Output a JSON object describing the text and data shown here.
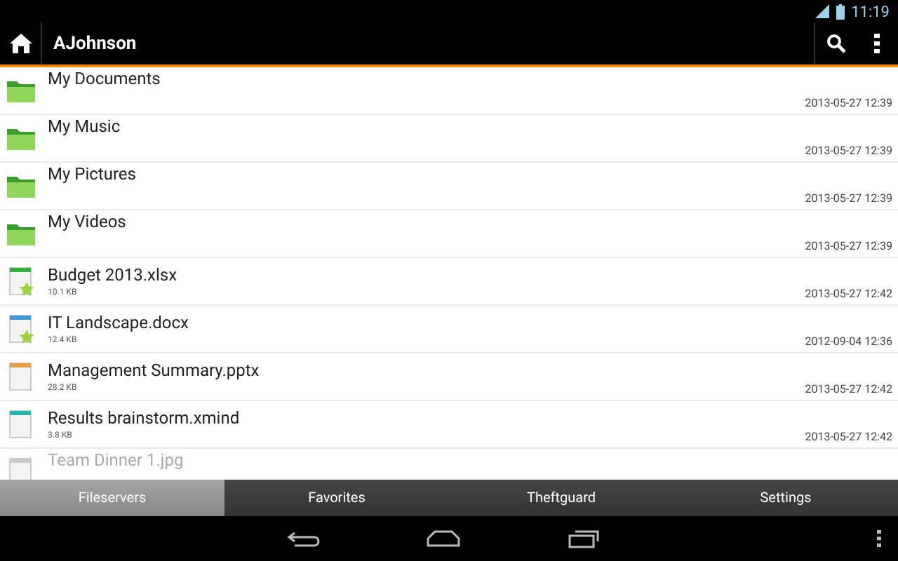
{
  "status_bar": {
    "time": "11:19"
  },
  "action_bar": {
    "title": "AJohnson"
  },
  "files": [
    {
      "kind": "folder",
      "name": "My Documents",
      "date": "2013-05-27 12:39"
    },
    {
      "kind": "folder",
      "name": "My Music",
      "date": "2013-05-27 12:39"
    },
    {
      "kind": "folder",
      "name": "My Pictures",
      "date": "2013-05-27 12:39"
    },
    {
      "kind": "folder",
      "name": "My Videos",
      "date": "2013-05-27 12:39"
    },
    {
      "kind": "file",
      "name": "Budget 2013.xlsx",
      "size": "10.1 KB",
      "date": "2013-05-27 12:42",
      "color": "#2fae3a",
      "favorite": true
    },
    {
      "kind": "file",
      "name": "IT Landscape.docx",
      "size": "12.4 KB",
      "date": "2012-09-04 12:36",
      "color": "#3a9ad9",
      "favorite": true
    },
    {
      "kind": "file",
      "name": "Management Summary.pptx",
      "size": "28.2 KB",
      "date": "2013-05-27 12:42",
      "color": "#e89a3c",
      "favorite": false
    },
    {
      "kind": "file",
      "name": "Results brainstorm.xmind",
      "size": "3.8 KB",
      "date": "2013-05-27 12:42",
      "color": "#1fb5b0",
      "favorite": false
    },
    {
      "kind": "file",
      "name": "Team Dinner 1.jpg"
    }
  ],
  "tabs": [
    {
      "label": "Fileservers",
      "selected": true
    },
    {
      "label": "Favorites",
      "selected": false
    },
    {
      "label": "Theftguard",
      "selected": false
    },
    {
      "label": "Settings",
      "selected": false
    }
  ]
}
